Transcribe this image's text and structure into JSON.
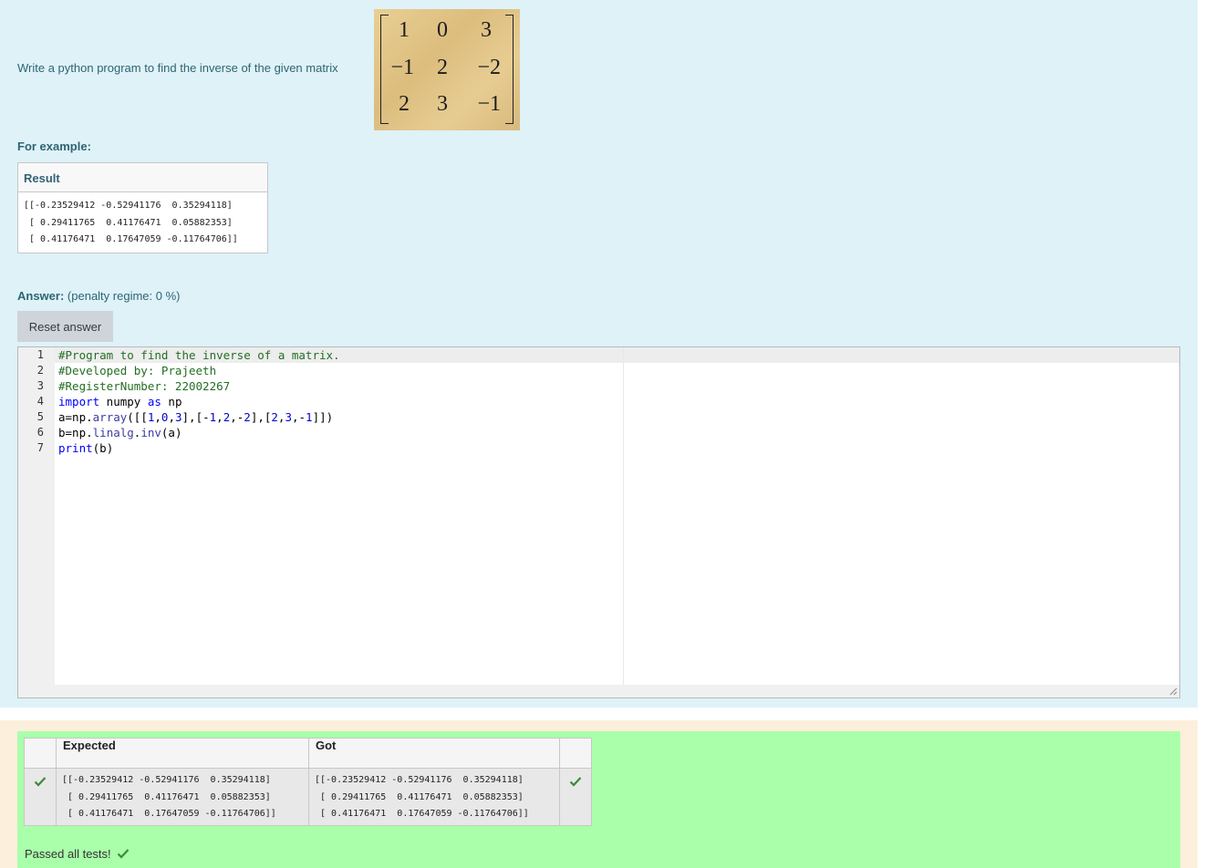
{
  "question": {
    "text": "Write a python program to find the inverse of the given matrix",
    "matrix": [
      [
        "1",
        "0",
        "3"
      ],
      [
        "−1",
        "2",
        "−2"
      ],
      [
        "2",
        "3",
        "−1"
      ]
    ],
    "example_label": "For example:",
    "result_header": "Result",
    "result_value": "[[-0.23529412 -0.52941176  0.35294118]\n [ 0.29411765  0.41176471  0.05882353]\n [ 0.41176471  0.17647059 -0.11764706]]",
    "answer_label": "Answer:",
    "penalty": "(penalty regime: 0 %)",
    "reset_button": "Reset answer"
  },
  "editor": {
    "line_numbers": [
      "1",
      "2",
      "3",
      "4",
      "5",
      "6",
      "7"
    ],
    "lines": [
      "#Program to find the inverse of a matrix.",
      "#Developed by: Prajeeth",
      "#RegisterNumber: 22002267",
      "import numpy as np",
      "a=np.array([[1,0,3],[-1,2,-2],[2,3,-1]])",
      "b=np.linalg.inv(a)",
      "print(b)"
    ]
  },
  "results": {
    "headers": {
      "expected": "Expected",
      "got": "Got"
    },
    "expected": "[[-0.23529412 -0.52941176  0.35294118]\n [ 0.29411765  0.41176471  0.05882353]\n [ 0.41176471  0.17647059 -0.11764706]]",
    "got": "[[-0.23529412 -0.52941176  0.35294118]\n [ 0.29411765  0.41176471  0.05882353]\n [ 0.41176471  0.17647059 -0.11764706]]",
    "passed_text": "Passed all tests!"
  },
  "colors": {
    "question_bg": "#def2f8",
    "outcome_bg": "#fcefdc",
    "pass_bg": "#aaffaa",
    "tick": "#3c8a3c"
  }
}
